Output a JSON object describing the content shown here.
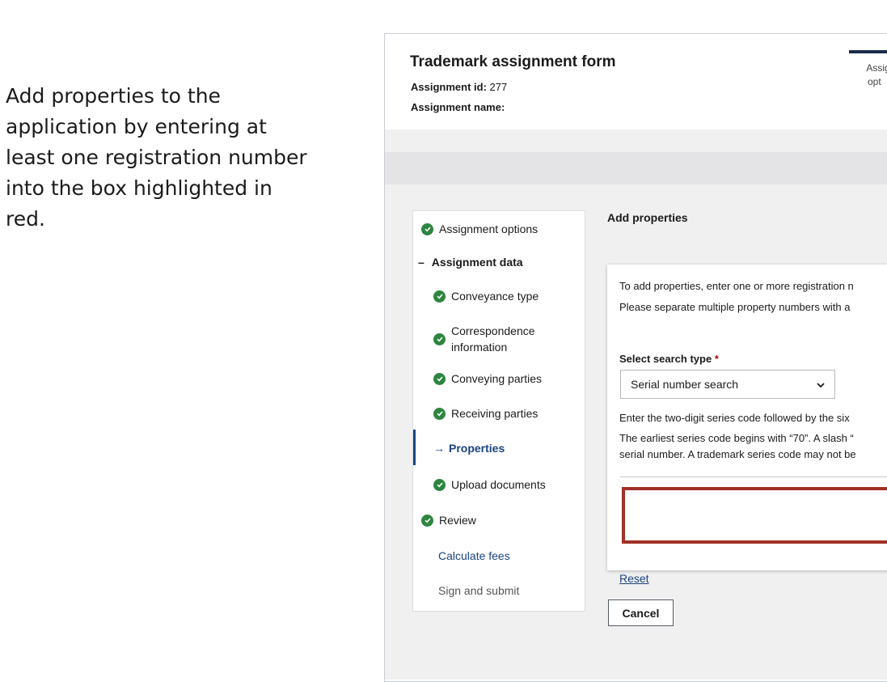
{
  "instruction": "Add properties to the application by entering at least one registration number into the box highlighted in red.",
  "form": {
    "title": "Trademark assignment form",
    "assignment_id_label": "Assignment id:",
    "assignment_id_value": "277",
    "assignment_name_label": "Assignment name:"
  },
  "stepper": {
    "current_step_line1": "Assig",
    "current_step_line2": "opt"
  },
  "nav": {
    "items": [
      {
        "label": "Assignment options",
        "status": "complete"
      },
      {
        "label": "Assignment data",
        "status": "expanded",
        "prefix": "–"
      },
      {
        "label": "Conveyance type",
        "status": "complete"
      },
      {
        "label": "Correspondence",
        "label2": "information",
        "status": "complete"
      },
      {
        "label": "Conveying parties",
        "status": "complete"
      },
      {
        "label": "Receiving parties",
        "status": "complete"
      },
      {
        "label": "Properties",
        "status": "current",
        "prefix": "→"
      },
      {
        "label": "Upload documents",
        "status": "complete"
      },
      {
        "label": "Review",
        "status": "complete"
      },
      {
        "label": "Calculate fees",
        "status": "link"
      },
      {
        "label": "Sign and submit",
        "status": "disabled"
      }
    ]
  },
  "main": {
    "heading": "Add properties",
    "intro_line1": "To add properties, enter one or more registration n",
    "intro_line2": "Please separate multiple property numbers with a",
    "select_label": "Select search type",
    "required_mark": "*",
    "select_value": "Serial number search",
    "help_line1": "Enter the two-digit series code followed by the six",
    "help_line2": "The earliest series code begins with “70”. A slash “",
    "help_line3": "serial number. A trademark series code may not be",
    "numbers_value": "",
    "reset_label": "Reset",
    "cancel_label": "Cancel"
  },
  "colors": {
    "check_green": "#2e8540",
    "link_blue": "#1a4480",
    "highlight_red": "#a13026"
  }
}
